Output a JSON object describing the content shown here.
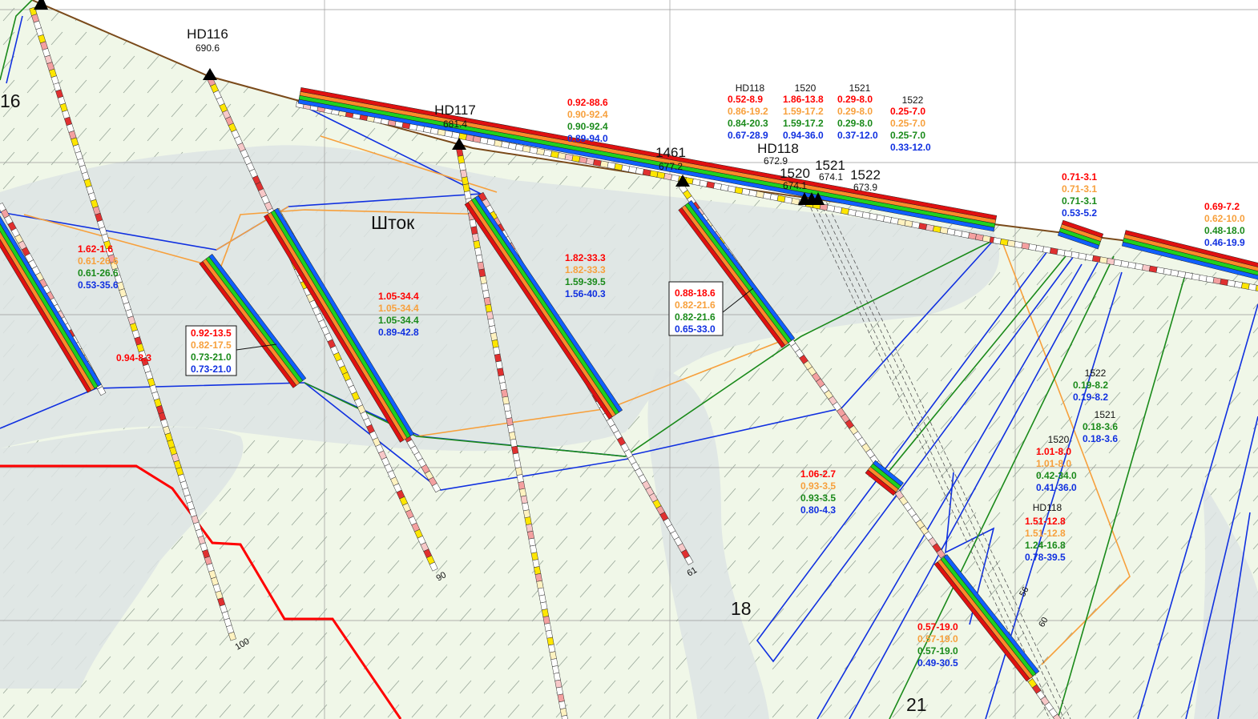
{
  "colors": {
    "red": "#ff0000",
    "orange": "#f7a03c",
    "green": "#1a8a1a",
    "blue": "#1030e0",
    "dark": "#111111"
  },
  "collars": [
    {
      "id": "HD116",
      "elev": "690.6"
    },
    {
      "id": "HD117",
      "elev": "681.4"
    },
    {
      "id": "1461",
      "elev": "677.2"
    },
    {
      "id": "HD118",
      "elev": "672.9"
    },
    {
      "id": "1520",
      "elev": "674.1"
    },
    {
      "id": "1521",
      "elev": "674.1"
    },
    {
      "id": "1522",
      "elev": "673.9"
    }
  ],
  "zones": {
    "shtok": "Шток",
    "z16": "16",
    "z18": "18",
    "z21": "21"
  },
  "depths": {
    "d100": "100",
    "d90": "90",
    "d61": "61",
    "d56": "56",
    "d60": "60"
  },
  "intervals": [
    {
      "id": "g1",
      "lines": [
        "1.62-1.6",
        "0.61-26.6",
        "0.61-26.6",
        "0.53-35.6"
      ]
    },
    {
      "id": "g2",
      "lines": [
        "0.94-8.3"
      ]
    },
    {
      "id": "g3",
      "lines": [
        "0.92-13.5",
        "0.82-17.5",
        "0.73-21.0",
        "0.73-21.0"
      ],
      "boxed": true
    },
    {
      "id": "g4",
      "lines": [
        "1.05-34.4",
        "1.05-34.4",
        "1.05-34.4",
        "0.89-42.8"
      ]
    },
    {
      "id": "g5",
      "lines": [
        "0.92-88.6",
        "0.90-92.4",
        "0.90-92.4",
        "0.89-94.0"
      ]
    },
    {
      "id": "g6",
      "lines": [
        "1.82-33.3",
        "1.82-33.3",
        "1.59-39.5",
        "1.56-40.3"
      ]
    },
    {
      "id": "g7",
      "lines": [
        "0.88-18.6",
        "0.82-21.6",
        "0.82-21.6",
        "0.65-33.0"
      ],
      "boxed": true
    },
    {
      "id": "g8",
      "hole": "HD118",
      "lines": [
        "0.52-8.9",
        "0.86-19.2",
        "0.84-20.3",
        "0.67-28.9"
      ]
    },
    {
      "id": "g9",
      "hole": "1520",
      "lines": [
        "1.86-13.8",
        "1.59-17.2",
        "1.59-17.2",
        "0.94-36.0"
      ]
    },
    {
      "id": "g10",
      "hole": "1521",
      "lines": [
        "0.29-8.0",
        "0.29-8.0",
        "0.29-8.0",
        "0.37-12.0"
      ]
    },
    {
      "id": "g11",
      "hole": "1522",
      "lines": [
        "0.25-7.0",
        "0.25-7.0",
        "0.25-7.0",
        "0.33-12.0"
      ]
    },
    {
      "id": "g12",
      "lines": [
        "0.71-3.1",
        "0.71-3.1",
        "0.71-3.1",
        "0.53-5.2"
      ]
    },
    {
      "id": "g13",
      "lines": [
        "0.69-7.2",
        "0.62-10.0",
        "0.48-18.0",
        "0.46-19.9"
      ]
    },
    {
      "id": "g14",
      "lines": [
        "1.06-2.7",
        "0.93-3.5",
        "0.93-3.5",
        "0.80-4.3"
      ]
    },
    {
      "id": "g15",
      "hole": "1522",
      "lines": [
        "0.19-8.2",
        "0.19-8.2"
      ],
      "colorOffset": 2
    },
    {
      "id": "g16",
      "hole": "1521",
      "lines": [
        "0.18-3.6",
        "0.18-3.6"
      ],
      "colorOffset": 2
    },
    {
      "id": "g17",
      "hole": "1520",
      "lines": [
        "1.01-8.0",
        "1.01-8.0",
        "0.42-34.0",
        "0.41-36.0"
      ]
    },
    {
      "id": "g18",
      "hole": "HD118",
      "lines": [
        "1.51-12.8",
        "1.51-12.8",
        "1.24-16.8",
        "0.78-39.5"
      ]
    },
    {
      "id": "g19",
      "lines": [
        "0.57-19.0",
        "0.57-19.0",
        "0.57-19.0",
        "0.49-30.5"
      ]
    }
  ]
}
